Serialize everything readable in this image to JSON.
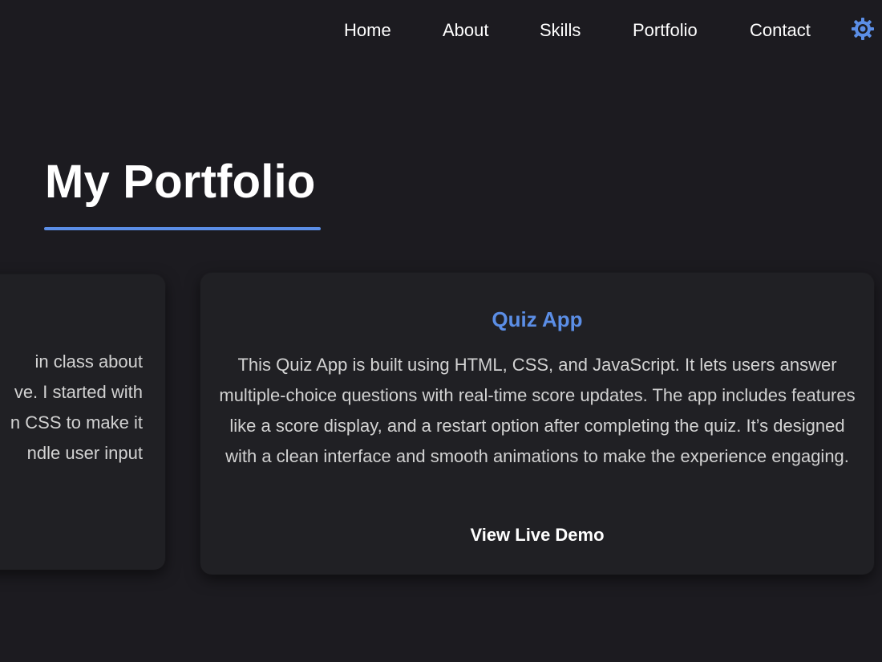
{
  "nav": {
    "items": [
      {
        "label": "Home"
      },
      {
        "label": "About"
      },
      {
        "label": "Skills"
      },
      {
        "label": "Portfolio"
      },
      {
        "label": "Contact"
      }
    ],
    "theme_toggle_icon": "gear-icon",
    "accent_color": "#5b8ee6"
  },
  "portfolio": {
    "title": "My Portfolio",
    "cards": [
      {
        "description_lines": [
          "in class about",
          "ve. I started with",
          "n CSS to make it",
          "ndle user input"
        ]
      },
      {
        "title": "Quiz App",
        "description": "This Quiz App is built using HTML, CSS, and JavaScript. It lets users answer multiple-choice questions with real-time score updates. The app includes features like a score display, and a restart option after completing the quiz. It’s designed with a clean interface and smooth animations to make the experience engaging.",
        "link_label": "View Live Demo"
      }
    ]
  },
  "colors": {
    "background": "#1c1b20",
    "card_background": "#202024",
    "accent": "#5b8ee6",
    "text": "#d2d2d2"
  }
}
